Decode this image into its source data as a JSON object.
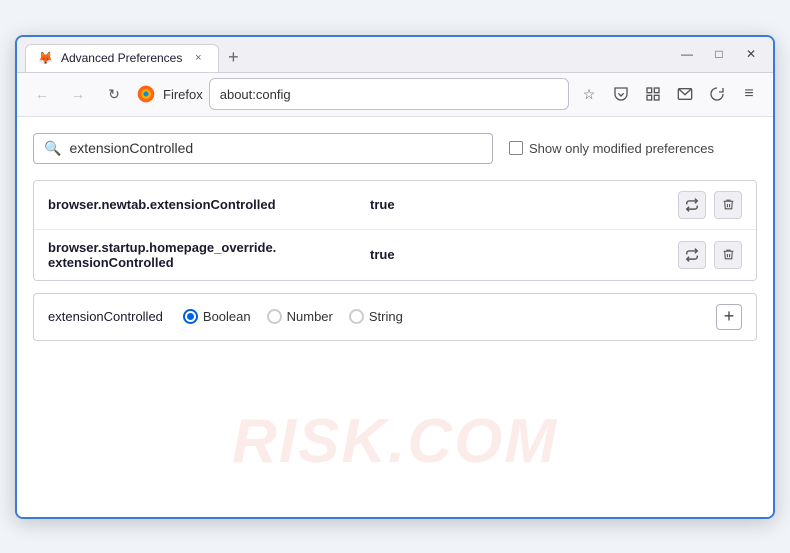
{
  "window": {
    "title": "Advanced Preferences",
    "tab_close_label": "×",
    "new_tab_label": "+",
    "minimize_label": "—",
    "maximize_label": "□",
    "close_label": "✕"
  },
  "nav": {
    "back_label": "←",
    "forward_label": "→",
    "reload_label": "↻",
    "browser_name": "Firefox",
    "address": "about:config",
    "bookmark_icon": "☆",
    "pocket_icon": "◫",
    "extension_icon": "⊞",
    "mail_icon": "✉",
    "account_icon": "↻",
    "menu_icon": "≡"
  },
  "search": {
    "placeholder": "extensionControlled",
    "value": "extensionControlled",
    "show_modified_label": "Show only modified preferences"
  },
  "preferences": [
    {
      "name": "browser.newtab.extensionControlled",
      "value": "true"
    },
    {
      "name_line1": "browser.startup.homepage_override.",
      "name_line2": "extensionControlled",
      "value": "true"
    }
  ],
  "new_pref": {
    "name": "extensionControlled",
    "type_boolean": "Boolean",
    "type_number": "Number",
    "type_string": "String",
    "add_label": "+"
  },
  "watermark": {
    "text": "RISK.COM"
  }
}
